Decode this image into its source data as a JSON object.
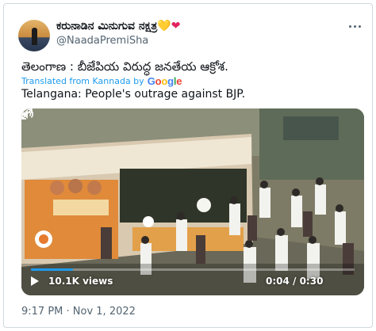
{
  "tweet": {
    "display_name": "ಕರುನಾಡಿನ ಮಿನುಗುವ ನಕ್ಷತ್ರ",
    "hearts": [
      "💛",
      "❤"
    ],
    "handle": "@NaadaPremiSha",
    "text": "తెలంగాణ : బీజేపియ విరుద్ధ జనతేయ ఆక్రోశ.",
    "translated_from": "Translated from Kannada by",
    "google_letters": [
      {
        "char": "G",
        "color": "#4285F4"
      },
      {
        "char": "o",
        "color": "#EA4335"
      },
      {
        "char": "o",
        "color": "#FBBC05"
      },
      {
        "char": "g",
        "color": "#4285F4"
      },
      {
        "char": "l",
        "color": "#34A853"
      },
      {
        "char": "e",
        "color": "#EA4335"
      }
    ],
    "translation": "Telangana: People's outrage against BJP.",
    "timestamp": "9:17 PM · Nov 1, 2022"
  },
  "video": {
    "views": "10.1K views",
    "time": "0:04 / 0:30",
    "progress": 0.13
  },
  "colors": {
    "accent": "#1d9bf0",
    "secondary_text": "#536471",
    "border": "#cfd9de"
  }
}
